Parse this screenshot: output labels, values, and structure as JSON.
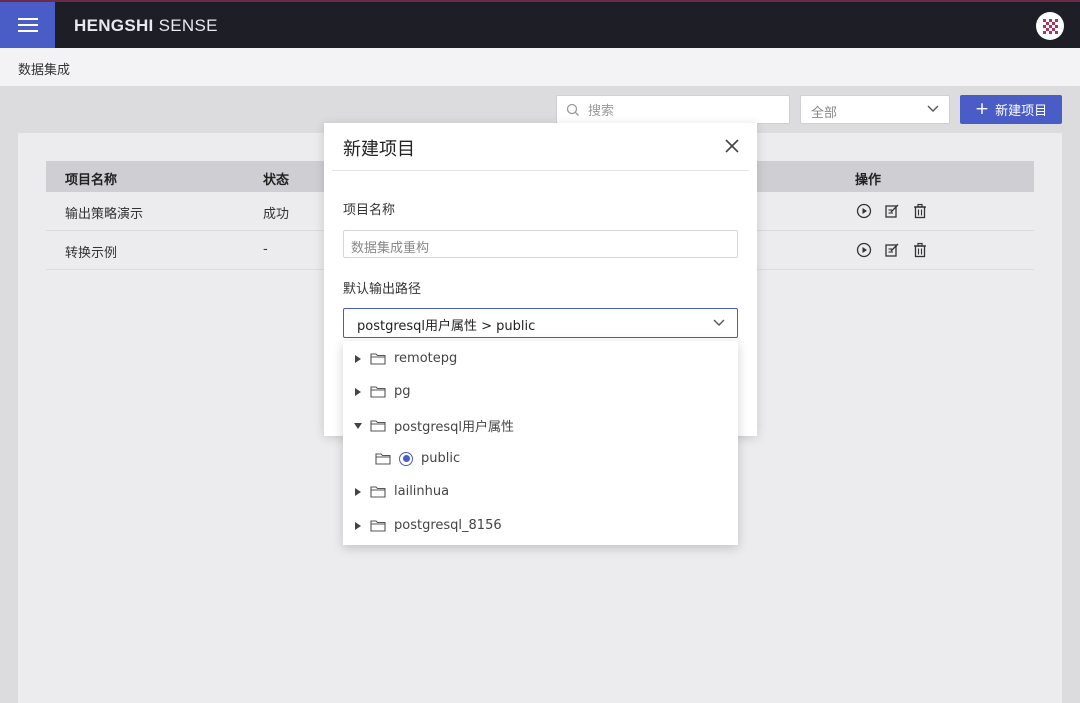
{
  "app": {
    "brand_bold": "HENGSHI",
    "brand_light": "SENSE",
    "menu_icon": "hamburger-icon",
    "avatar_icon": "user-avatar-icon"
  },
  "breadcrumb": "数据集成",
  "toolbar": {
    "search_placeholder": "搜索",
    "filter_value": "全部",
    "new_button": "新建项目"
  },
  "table": {
    "columns": [
      "项目名称",
      "状态",
      "操作"
    ],
    "rows": [
      {
        "name": "输出策略演示",
        "status": "成功"
      },
      {
        "name": "转换示例",
        "status": "-"
      }
    ],
    "row_actions": [
      "play-icon",
      "edit-icon",
      "delete-icon"
    ]
  },
  "modal": {
    "title": "新建项目",
    "name_label": "项目名称",
    "name_placeholder": "数据集成重构",
    "path_label": "默认输出路径",
    "path_value": "postgresql用户属性 > public"
  },
  "tree": {
    "nodes": [
      {
        "label": "remotepg",
        "expanded": false,
        "level": 0
      },
      {
        "label": "pg",
        "expanded": false,
        "level": 0
      },
      {
        "label": "postgresql用户属性",
        "expanded": true,
        "level": 0
      },
      {
        "label": "public",
        "selected": true,
        "level": 1
      },
      {
        "label": "lailinhua",
        "expanded": false,
        "level": 0
      },
      {
        "label": "postgresql_8156",
        "expanded": false,
        "level": 0
      }
    ]
  },
  "colors": {
    "accent": "#4a5cc5",
    "topbar": "#1e1e26"
  }
}
